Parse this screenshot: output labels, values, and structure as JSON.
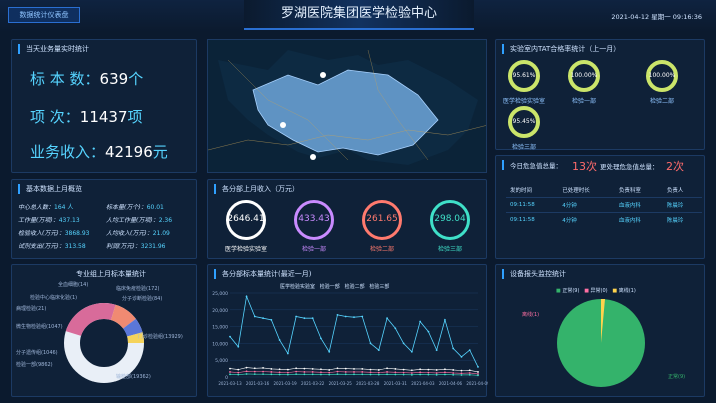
{
  "header": {
    "tag": "数据统计仪表盘",
    "title": "罗湖医院集团医学检验中心",
    "datetime": "2021-04-12  星期一  09:16:36"
  },
  "business_today": {
    "title": "当天业务量实时统计",
    "samples_label": "标 本 数：",
    "samples_value": "639",
    "samples_unit": "个",
    "items_label": "项    次：",
    "items_value": "11437",
    "items_unit": "项",
    "revenue_label": "业务收入：",
    "revenue_value": "42196",
    "revenue_unit": "元"
  },
  "monthly_overview": {
    "title": "基本数据上月概览",
    "rows": [
      {
        "label": "中心总人数：",
        "value": "164 人",
        "label2": "标本量(万个)：",
        "value2": "60.01"
      },
      {
        "label": "工作量(万项)：",
        "value": "437.13",
        "label2": "人均工作量(万项)：",
        "value2": "2.36"
      },
      {
        "label": "检验收入(万元)：",
        "value": "3868.93",
        "label2": "人均收入(万元)：",
        "value2": "21.09"
      },
      {
        "label": "试剂支出(万元)：",
        "value": "313.58",
        "label2": "利润(万元)：",
        "value2": "3231.96"
      }
    ]
  },
  "dept_income": {
    "title": "各分部上月收入（万元）",
    "items": [
      {
        "value": "2646.41",
        "label": "医学检验实验室",
        "color": "#ffffff"
      },
      {
        "value": "433.43",
        "label": "检验一部",
        "color": "#c98bff"
      },
      {
        "value": "261.65",
        "label": "检验二部",
        "color": "#ff7a6e"
      },
      {
        "value": "298.04",
        "label": "检验三部",
        "color": "#3fe0c8"
      }
    ]
  },
  "tat": {
    "title": "实验室内TAT合格率统计（上一月）",
    "items": [
      {
        "value": "95.61%",
        "label": "医学检验实验室"
      },
      {
        "value": "100.00%",
        "label": "检验一部"
      },
      {
        "value": "100.00%",
        "label": "检验二部"
      },
      {
        "value": "95.45%",
        "label": "检验三部"
      }
    ]
  },
  "urgent": {
    "title": "今日危急值总量：",
    "count": "13次",
    "handled_title": "更处理危急值总量：",
    "handled_count": "2次",
    "columns": [
      "发的时间",
      "已处理时长",
      "负责科室",
      "负责人"
    ],
    "rows": [
      [
        "09:11:58",
        "4分钟",
        "血液内科",
        "陈晨玲"
      ],
      [
        "09:11:58",
        "4分钟",
        "血液内科",
        "陈晨玲"
      ]
    ]
  },
  "donut": {
    "title": "专业组上月标本量统计",
    "labels": [
      "全血细胞(14)",
      "临床免疫检验(172)",
      "检验中心临床化验(1)",
      "分子诊断检验(84)",
      "病理检验(21)",
      "门诊检验组(13929)",
      "检验一部(9862)",
      "输检部(19362)",
      "微生物检验组(1047)",
      "分子遗传组(1046)"
    ]
  },
  "line_chart": {
    "title": "各分部标本量统计(最近一月)",
    "legend": [
      "医学检验实验室",
      "检验一部",
      "检验二部",
      "检验三部"
    ],
    "y_ticks": [
      "25,000",
      "20,000",
      "15,000",
      "10,000",
      "5,000",
      "0"
    ],
    "x_ticks": [
      "2021-03-13",
      "2021-03-16",
      "2021-03-19",
      "2021-03-22",
      "2021-03-25",
      "2021-03-28",
      "2021-03-31",
      "2021-04-03",
      "2021-04-06",
      "2021-04-09"
    ]
  },
  "chart_data": {
    "type": "line",
    "x": [
      "2021-03-13",
      "2021-03-14",
      "2021-03-15",
      "2021-03-16",
      "2021-03-17",
      "2021-03-18",
      "2021-03-19",
      "2021-03-20",
      "2021-03-21",
      "2021-03-22",
      "2021-03-23",
      "2021-03-24",
      "2021-03-25",
      "2021-03-26",
      "2021-03-27",
      "2021-03-28",
      "2021-03-29",
      "2021-03-30",
      "2021-03-31",
      "2021-04-01",
      "2021-04-02",
      "2021-04-03",
      "2021-04-04",
      "2021-04-05",
      "2021-04-06",
      "2021-04-07",
      "2021-04-08",
      "2021-04-09",
      "2021-04-10",
      "2021-04-11",
      "2021-04-12"
    ],
    "ylim": [
      0,
      25000
    ],
    "series": [
      {
        "name": "医学检验实验室",
        "values": [
          12000,
          9000,
          24000,
          18000,
          17500,
          17000,
          11000,
          7000,
          18000,
          17500,
          17500,
          11500,
          7500,
          18500,
          18000,
          17800,
          18000,
          10000,
          8000,
          17500,
          14500,
          10000,
          7500,
          16500,
          13500,
          8000,
          17000,
          8500,
          6000,
          8000,
          3000
        ]
      },
      {
        "name": "检验一部",
        "values": [
          2500,
          2200,
          2800,
          2600,
          2700,
          2400,
          2300,
          2200,
          2600,
          2500,
          2400,
          2300,
          2100,
          2600,
          2500,
          2400,
          2400,
          2200,
          2100,
          2600,
          2400,
          2200,
          2000,
          2300,
          2200,
          2100,
          2300,
          2100,
          1900,
          2000,
          1500
        ]
      },
      {
        "name": "检验二部",
        "values": [
          1500,
          1300,
          1700,
          1600,
          1600,
          1500,
          1400,
          1300,
          1600,
          1500,
          1500,
          1400,
          1300,
          1600,
          1500,
          1500,
          1500,
          1400,
          1300,
          1500,
          1400,
          1300,
          1200,
          1400,
          1300,
          1200,
          1400,
          1200,
          1100,
          1200,
          900
        ]
      },
      {
        "name": "检验三部",
        "values": [
          800,
          700,
          900,
          850,
          850,
          800,
          750,
          700,
          850,
          800,
          800,
          750,
          700,
          850,
          800,
          800,
          800,
          750,
          700,
          800,
          750,
          700,
          650,
          750,
          700,
          650,
          750,
          650,
          600,
          650,
          500
        ]
      }
    ]
  },
  "device": {
    "title": "设备报头监控统计",
    "legend": [
      "正常(9)",
      "异常(0)",
      "离线(1)"
    ],
    "slice_labels": [
      "离线(1)",
      "正常(9)"
    ],
    "colors": [
      "#34b36b",
      "#ff6fa3",
      "#ffd34d"
    ]
  }
}
